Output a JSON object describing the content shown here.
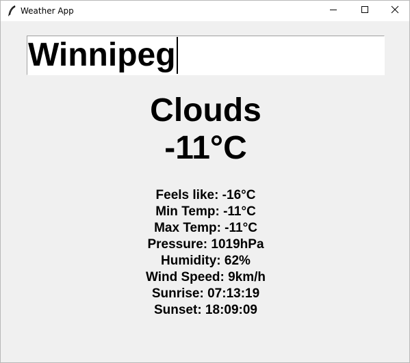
{
  "window": {
    "title": "Weather App",
    "icon": "feather-icon",
    "controls": [
      "minimize-icon",
      "maximize-icon",
      "close-icon"
    ]
  },
  "search": {
    "city_value": "Winnipeg"
  },
  "weather": {
    "condition": "Clouds",
    "temperature": "-11°C",
    "details": [
      "Feels like: -16°C",
      "Min Temp: -11°C",
      "Max Temp: -11°C",
      "Pressure: 1019hPa",
      "Humidity: 62%",
      "Wind Speed: 9km/h",
      "Sunrise: 07:13:19",
      "Sunset: 18:09:09"
    ]
  }
}
